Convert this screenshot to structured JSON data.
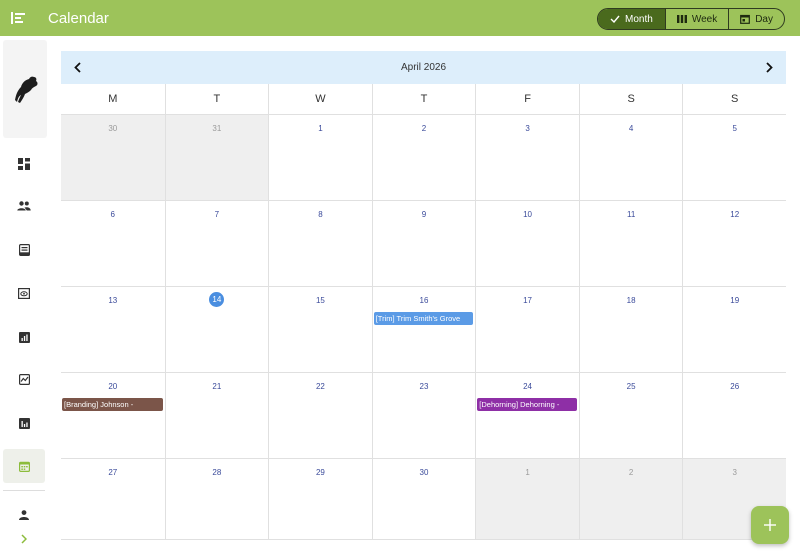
{
  "app": {
    "title": "Calendar"
  },
  "colors": {
    "brand": "#9dc35a",
    "today": "#4a8ee0"
  },
  "views": [
    {
      "label": "Month",
      "icon": "check-icon",
      "active": true
    },
    {
      "label": "Week",
      "icon": "week-view-icon",
      "active": false
    },
    {
      "label": "Day",
      "icon": "day-view-icon",
      "active": false
    }
  ],
  "sidebar": {
    "logo": "bull-logo",
    "items": [
      {
        "icon": "dashboard-icon"
      },
      {
        "icon": "people-icon"
      },
      {
        "icon": "records-icon"
      },
      {
        "icon": "preview-icon"
      },
      {
        "icon": "analytics-icon"
      },
      {
        "icon": "trend-chart-icon"
      },
      {
        "icon": "bar-chart-icon"
      },
      {
        "icon": "calendar-icon",
        "active": true
      }
    ],
    "bottom": [
      {
        "icon": "account-icon"
      },
      {
        "icon": "expand-chevron-icon"
      }
    ]
  },
  "calendar": {
    "month_label": "April 2026",
    "weekdays": [
      "M",
      "T",
      "W",
      "T",
      "F",
      "S",
      "S"
    ],
    "weeks": [
      [
        {
          "day": "30",
          "outside": true
        },
        {
          "day": "31",
          "outside": true
        },
        {
          "day": "1"
        },
        {
          "day": "2"
        },
        {
          "day": "3"
        },
        {
          "day": "4"
        },
        {
          "day": "5"
        }
      ],
      [
        {
          "day": "6"
        },
        {
          "day": "7"
        },
        {
          "day": "8"
        },
        {
          "day": "9"
        },
        {
          "day": "10"
        },
        {
          "day": "11"
        },
        {
          "day": "12"
        }
      ],
      [
        {
          "day": "13"
        },
        {
          "day": "14",
          "today": true
        },
        {
          "day": "15"
        },
        {
          "day": "16",
          "event": {
            "label": "[Trim] Trim Smith's Grove",
            "color": "#5b9be6"
          }
        },
        {
          "day": "17"
        },
        {
          "day": "18"
        },
        {
          "day": "19"
        }
      ],
      [
        {
          "day": "20",
          "event": {
            "label": "[Branding] Johnson -",
            "color": "#7b5549"
          }
        },
        {
          "day": "21"
        },
        {
          "day": "22"
        },
        {
          "day": "23"
        },
        {
          "day": "24",
          "event": {
            "label": "[Dehorning] Dehorning -",
            "color": "#8e2fa6"
          }
        },
        {
          "day": "25"
        },
        {
          "day": "26"
        }
      ],
      [
        {
          "day": "27"
        },
        {
          "day": "28"
        },
        {
          "day": "29"
        },
        {
          "day": "30"
        },
        {
          "day": "1",
          "outside": true
        },
        {
          "day": "2",
          "outside": true
        },
        {
          "day": "3",
          "outside": true
        }
      ]
    ]
  },
  "fab": {
    "icon": "plus-icon"
  }
}
